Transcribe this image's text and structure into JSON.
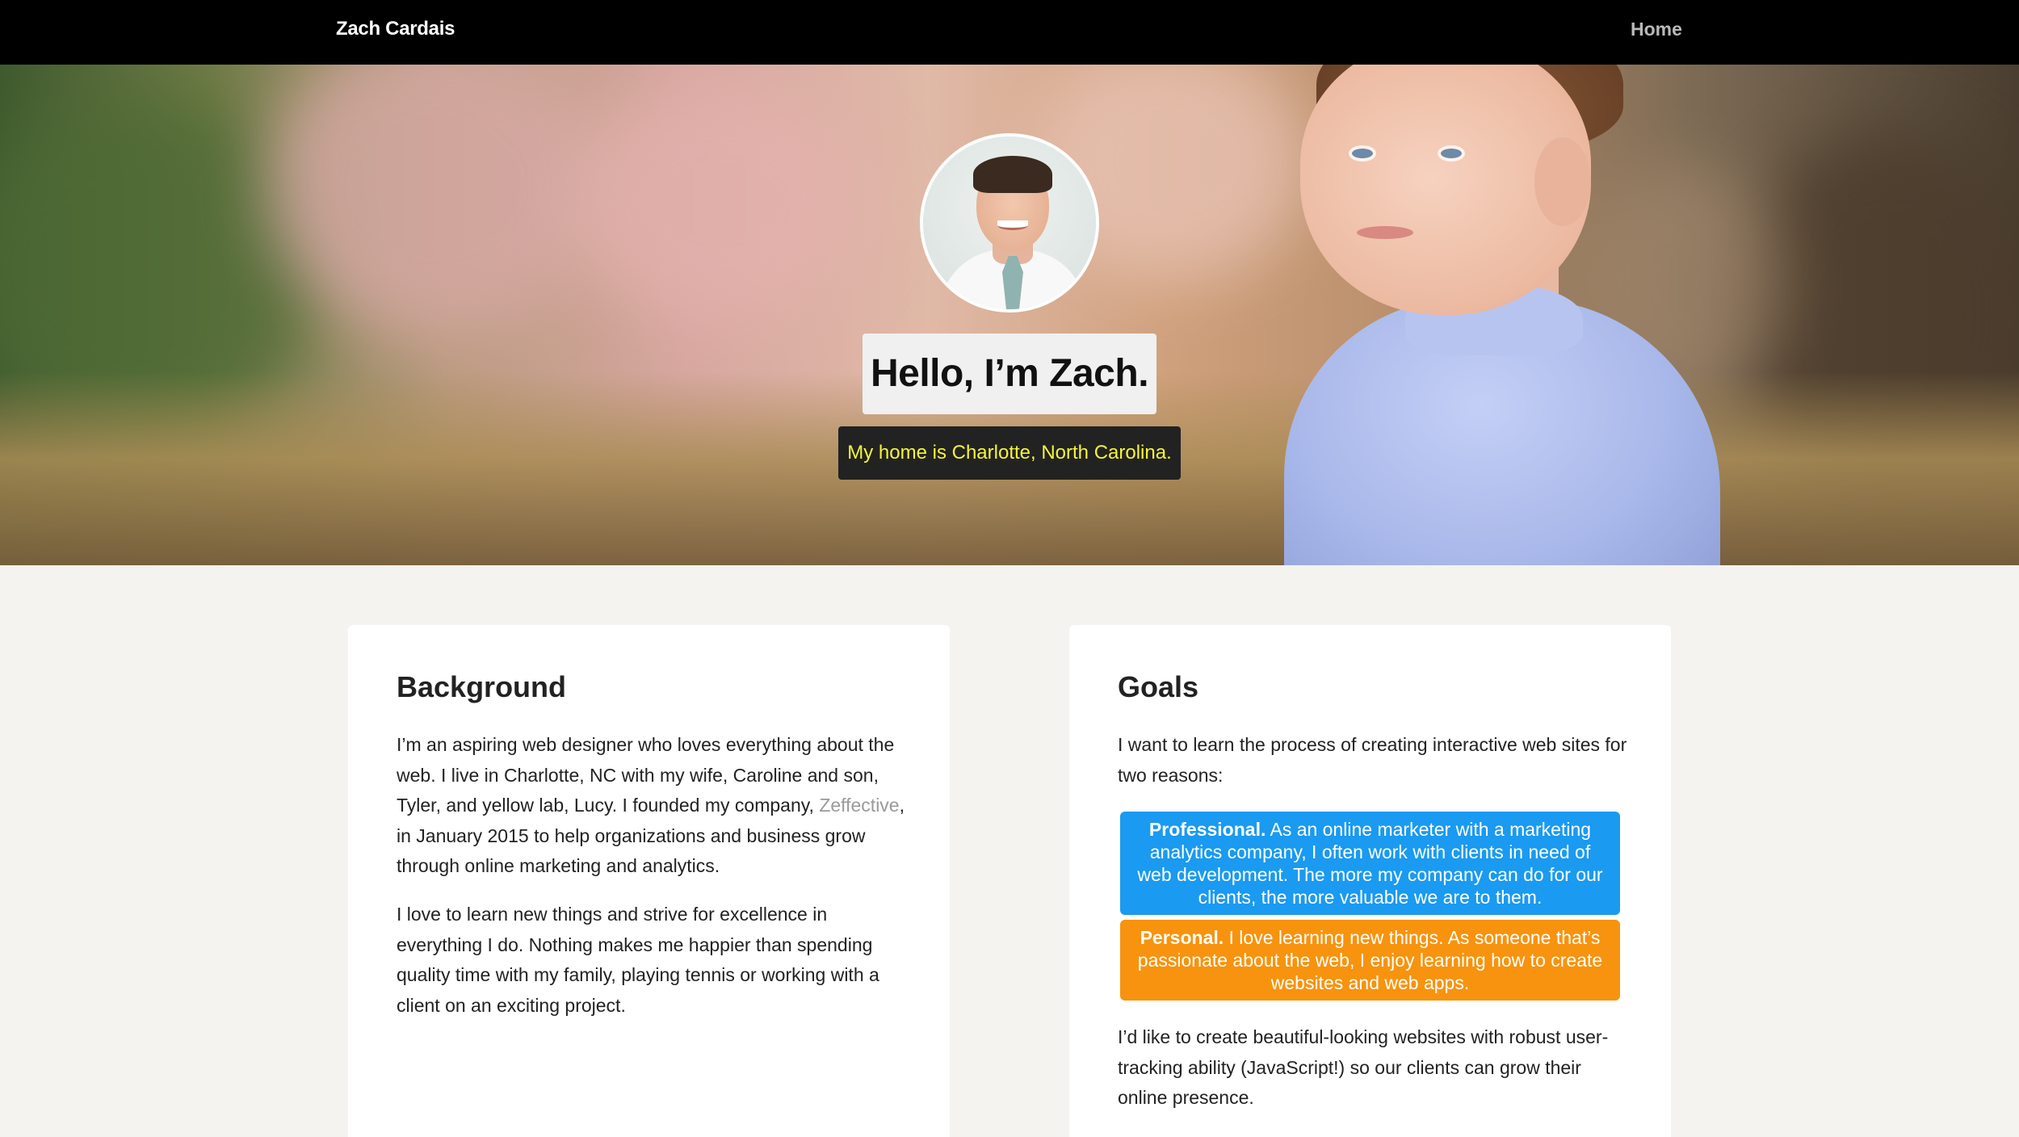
{
  "nav": {
    "brand": "Zach Cardais",
    "home_link": "Home"
  },
  "hero": {
    "greeting": "Hello, I’m Zach.",
    "subtitle": "My home is Charlotte, North Carolina."
  },
  "background": {
    "heading": "Background",
    "p1_before_link": "I’m an aspiring web designer who loves everything about the web. I live in Charlotte, NC with my wife, Caroline and son, Tyler, and yellow lab, Lucy. I founded my company, ",
    "p1_link": "Zeffective",
    "p1_after_link": ", in January 2015 to help organizations and business grow through online marketing and analytics.",
    "p2": "I love to learn new things and strive for excellence in everything I do. Nothing makes me happier than spending quality time with my family, playing tennis or working with a client on an exciting project."
  },
  "goals": {
    "heading": "Goals",
    "p1": "I want to learn the process of creating interactive web sites for two reasons:",
    "reasons": [
      {
        "title": "Professional.",
        "text": " As an online marketer with a marketing analytics company, I often work with clients in need of web development. The more my company can do for our clients, the more valuable we are to them.",
        "color": "#1a9af0"
      },
      {
        "title": "Personal.",
        "text": " I love learning new things. As someone that’s passionate about the web, I enjoy learning how to create websites and web apps.",
        "color": "#f7930e"
      }
    ],
    "p3": "I’d like to create beautiful-looking websites with robust user-tracking ability (JavaScript!) so our clients can grow their online presence."
  },
  "colors": {
    "navbar": "#000000",
    "page_background": "#f4f3ef",
    "subtitle_text": "#f5f538",
    "link": "#9a9a9a"
  }
}
